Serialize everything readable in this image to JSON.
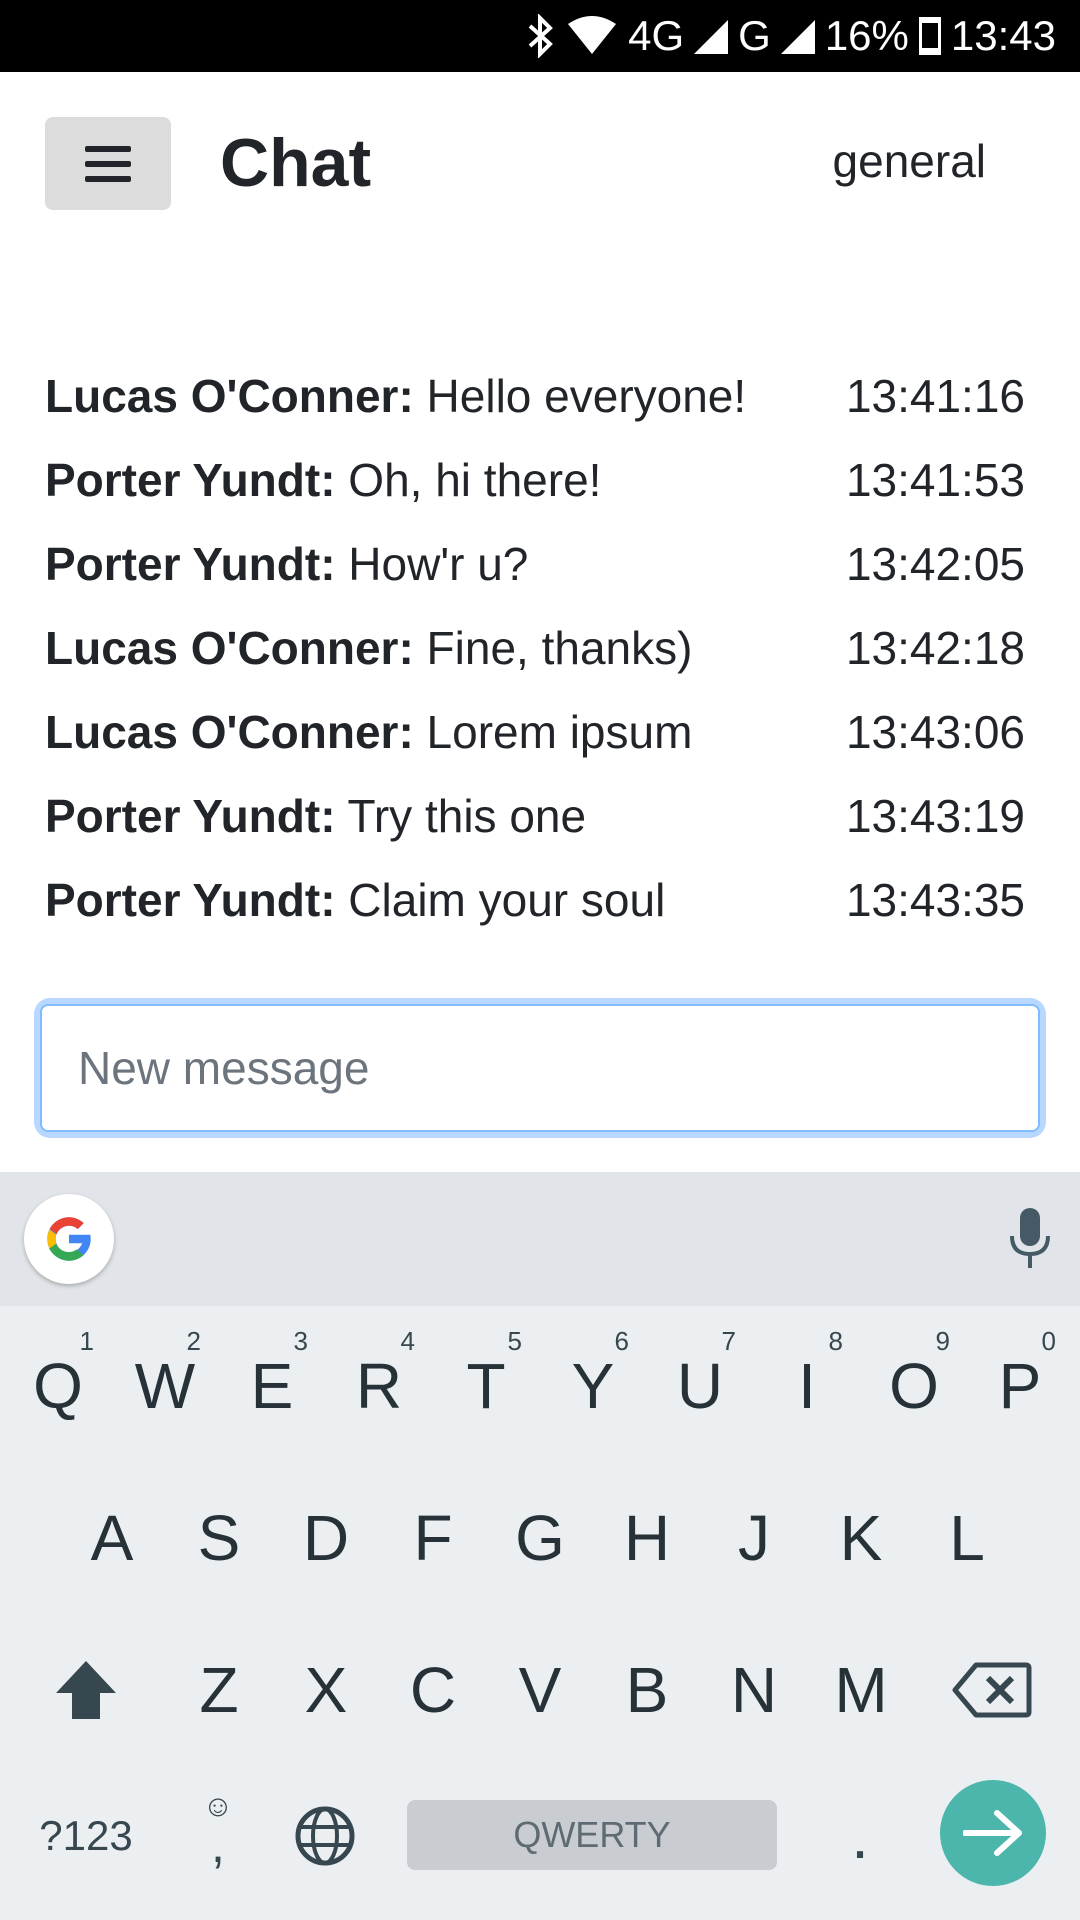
{
  "status_bar": {
    "network": "4G",
    "network2": "G",
    "battery": "16%",
    "time": "13:43",
    "icons": [
      "bluetooth-icon",
      "wifi-icon",
      "signal-icon",
      "battery-icon"
    ]
  },
  "header": {
    "menu_icon": "hamburger-menu-icon",
    "title": "Chat",
    "channel": "general"
  },
  "messages": [
    {
      "author": "Lucas O'Conner:",
      "text": "Hello everyone!",
      "time": "13:41:16"
    },
    {
      "author": "Porter Yundt:",
      "text": "Oh, hi there!",
      "time": "13:41:53"
    },
    {
      "author": "Porter Yundt:",
      "text": "How'r u?",
      "time": "13:42:05"
    },
    {
      "author": "Lucas O'Conner:",
      "text": "Fine, thanks)",
      "time": "13:42:18"
    },
    {
      "author": "Lucas O'Conner:",
      "text": "Lorem ipsum",
      "time": "13:43:06"
    },
    {
      "author": "Porter Yundt:",
      "text": "Try this one",
      "time": "13:43:19"
    },
    {
      "author": "Porter Yundt:",
      "text": "Claim your soul",
      "time": "13:43:35"
    }
  ],
  "composer": {
    "placeholder": "New message",
    "value": ""
  },
  "keyboard": {
    "row1": [
      {
        "key": "Q",
        "hint": "1"
      },
      {
        "key": "W",
        "hint": "2"
      },
      {
        "key": "E",
        "hint": "3"
      },
      {
        "key": "R",
        "hint": "4"
      },
      {
        "key": "T",
        "hint": "5"
      },
      {
        "key": "Y",
        "hint": "6"
      },
      {
        "key": "U",
        "hint": "7"
      },
      {
        "key": "I",
        "hint": "8"
      },
      {
        "key": "O",
        "hint": "9"
      },
      {
        "key": "P",
        "hint": "0"
      }
    ],
    "row2": [
      "A",
      "S",
      "D",
      "F",
      "G",
      "H",
      "J",
      "K",
      "L"
    ],
    "row3": [
      "Z",
      "X",
      "C",
      "V",
      "B",
      "N",
      "M"
    ],
    "symbols_label": "?123",
    "emoji_comma": ",",
    "period": ".",
    "space_label": "QWERTY",
    "colors": {
      "enter": "#4db6ac",
      "background": "#eceff1",
      "accent_focus": "#80bdff"
    }
  }
}
